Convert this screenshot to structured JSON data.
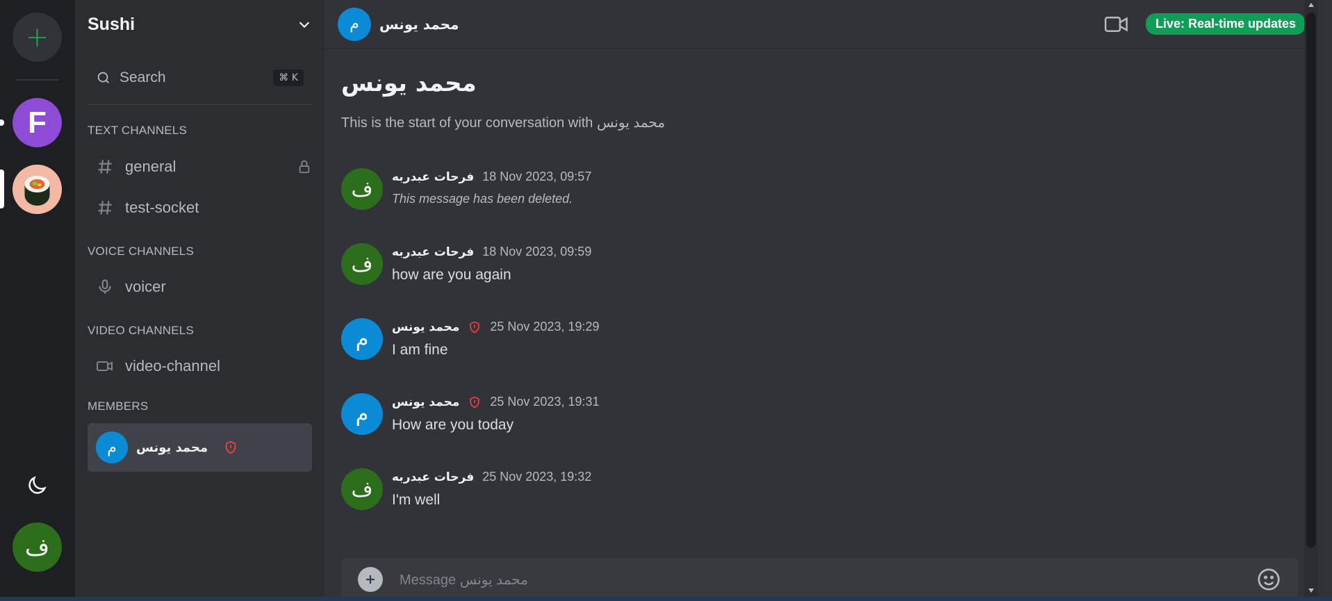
{
  "server": {
    "name": "Sushi",
    "rail": {
      "add_label": "+",
      "server_f_initial": "F",
      "user_initial": "ف"
    }
  },
  "search": {
    "label": "Search",
    "shortcut": "⌘ K"
  },
  "sections": {
    "text": "TEXT CHANNELS",
    "voice": "VOICE CHANNELS",
    "video": "VIDEO CHANNELS",
    "members": "MEMBERS"
  },
  "channels": {
    "text": [
      {
        "name": "general",
        "icon": "hash-icon",
        "locked": true
      },
      {
        "name": "test-socket",
        "icon": "hash-icon",
        "locked": false
      }
    ],
    "voice": [
      {
        "name": "voicer",
        "icon": "mic-icon"
      }
    ],
    "video": [
      {
        "name": "video-channel",
        "icon": "video-icon"
      }
    ]
  },
  "members": [
    {
      "name": "محمد يونس",
      "initial": "م",
      "role": "shield-alert-icon"
    }
  ],
  "header": {
    "name": "محمد يونس",
    "initial": "م",
    "live_label": "Live: Real-time updates"
  },
  "intro": {
    "title": "محمد يونس",
    "subtitle": "This is the start of your conversation with محمد يونس"
  },
  "messages": [
    {
      "author": "فرحات عبدربه",
      "initial": "ف",
      "time": "18 Nov 2023, 09:57",
      "text": "This message has been deleted.",
      "deleted": true,
      "admin": false,
      "color": "#2d6e1c"
    },
    {
      "author": "فرحات عبدربه",
      "initial": "ف",
      "time": "18 Nov 2023, 09:59",
      "text": "how are you again",
      "deleted": false,
      "admin": false,
      "color": "#2d6e1c"
    },
    {
      "author": "محمد يونس",
      "initial": "م",
      "time": "25 Nov 2023, 19:29",
      "text": "I am fine",
      "deleted": false,
      "admin": true,
      "color": "#0b8ad6"
    },
    {
      "author": "محمد يونس",
      "initial": "م",
      "time": "25 Nov 2023, 19:31",
      "text": "How are you today",
      "deleted": false,
      "admin": true,
      "color": "#0b8ad6"
    },
    {
      "author": "فرحات عبدربه",
      "initial": "ف",
      "time": "25 Nov 2023, 19:32",
      "text": "I'm well",
      "deleted": false,
      "admin": false,
      "color": "#2d6e1c"
    }
  ],
  "composer": {
    "placeholder": "Message محمد يونس"
  },
  "colors": {
    "accent_green": "#23a55a",
    "live_green": "#0f9d58",
    "admin_red": "#f23f43"
  }
}
